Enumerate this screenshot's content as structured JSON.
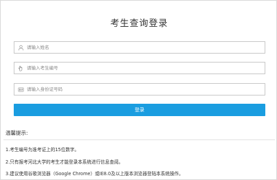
{
  "login": {
    "title": "考生查询登录",
    "name_field": {
      "placeholder": "请输入姓名",
      "icon": "user-icon"
    },
    "exam_number_field": {
      "placeholder": "请输入考生编号",
      "icon": "hand-icon"
    },
    "id_card_field": {
      "placeholder": "请输入身份证号码",
      "icon": "id-card-icon"
    },
    "login_button_label": "登录",
    "accent_color": "#1a9de0"
  },
  "tips": {
    "title": "温馨提示:",
    "items": [
      "1.考生编号为准考证上的15位数字。",
      "2.只有报考河北大学的考生才能登录本系统进行信息查阅。",
      "3.建议使用谷歌浏览器（Google Chrome）或IE8.0及以上版本浏览器登陆本系统操作。"
    ]
  }
}
